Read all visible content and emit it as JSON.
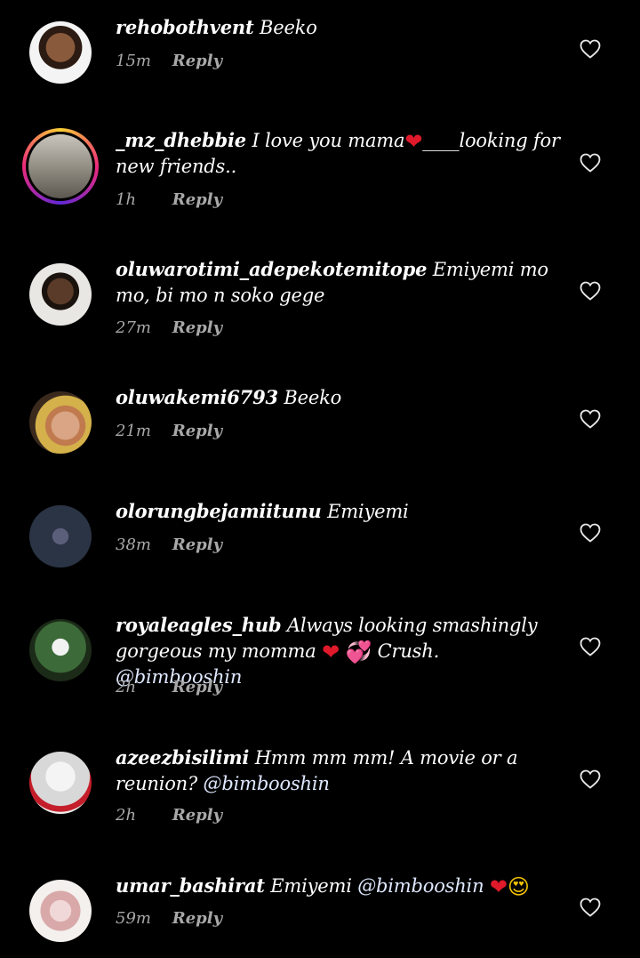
{
  "reply_label": "Reply",
  "colors": {
    "background": "#000000",
    "meta": "#a8a8a8",
    "heart_emoji": "#e01a2b"
  },
  "comments": [
    {
      "user": "rehobothvent",
      "text": "Beeko",
      "time": "15m"
    },
    {
      "user": "_mz_dhebbie",
      "text": "I love you mama",
      "emoji1": "❤",
      "text2": "____looking for new friends..",
      "time": "1h"
    },
    {
      "user": "oluwarotimi_adepekotemitope",
      "text": "Emiyemi mo mo, bi mo n soko gege",
      "time": "27m"
    },
    {
      "user": "oluwakemi6793",
      "text": "Beeko",
      "time": "21m"
    },
    {
      "user": "olorungbejamiitunu",
      "text": "Emiyemi",
      "time": "38m"
    },
    {
      "user": "royaleagles_hub",
      "text": "Always looking smashingly gorgeous my momma",
      "emoji1": "❤",
      "emoji2": "💞",
      "text2": "Crush.",
      "mention": "@bimbooshin",
      "time": "2h"
    },
    {
      "user": "azeezbisilimi",
      "text": "Hmm mm mm!  A movie or a reunion?",
      "mention": "@bimbooshin",
      "time": "2h"
    },
    {
      "user": "umar_bashirat",
      "text": "Emiyemi",
      "mention": "@bimbooshin",
      "emoji1": "❤",
      "emoji2": "😍",
      "time": "59m"
    }
  ]
}
